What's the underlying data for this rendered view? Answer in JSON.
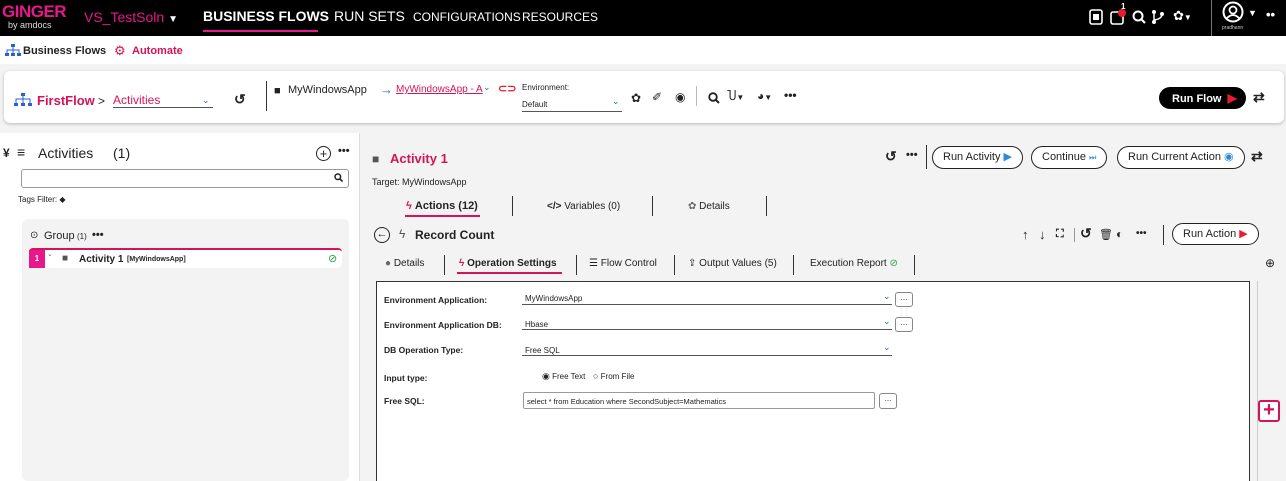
{
  "topbar": {
    "logo_text": "GINGER",
    "logo_sub": "by amdocs",
    "solution": "VS_TestSoln",
    "nav": [
      "BUSINESS FLOWS",
      "RUN SETS",
      "CONFIGURATIONS",
      "RESOURCES"
    ],
    "user": "pradhann",
    "badge_count": "1"
  },
  "breadcrumb": {
    "item1": "Business Flows",
    "item2": "Automate"
  },
  "toolbar": {
    "flow_name": "FirstFlow",
    "separator": ">",
    "view": "Activities",
    "target_app": "MyWindowsApp",
    "target_mapping": "MyWindowsApp - A",
    "environment_label": "Environment:",
    "environment_value": "Default",
    "run_flow": "Run Flow"
  },
  "left_panel": {
    "title": "Activities",
    "count": "(1)",
    "search_placeholder": "",
    "tags_filter": "Tags Filter:",
    "group_name": "Group",
    "group_count": "(1)",
    "activity_index": "1",
    "activity_name": "Activity 1",
    "activity_target": "[MyWindowsApp]"
  },
  "activity": {
    "title": "Activity 1",
    "target": "Target: MyWindowsApp",
    "run_activity": "Run Activity",
    "continue": "Continue",
    "run_current_action": "Run Current Action",
    "tabs": [
      "Actions (12)",
      "Variables (0)",
      "Details"
    ]
  },
  "action": {
    "name": "Record Count",
    "run_action": "Run Action",
    "tabs": [
      "Details",
      "Operation Settings",
      "Flow Control",
      "Output Values (5)",
      "Execution Report"
    ]
  },
  "form": {
    "env_app_label": "Environment Application:",
    "env_app_value": "MyWindowsApp",
    "env_db_label": "Environment Application DB:",
    "env_db_value": "Hbase",
    "db_op_label": "DB Operation Type:",
    "db_op_value": "Free SQL",
    "input_type_label": "Input type:",
    "input_opt1": "Free Text",
    "input_opt2": "From File",
    "free_sql_label": "Free SQL:",
    "free_sql_value": "select  * from Education where SecondSubject=Mathematics",
    "browse": "..."
  },
  "colors": {
    "accent": "#d4145a",
    "blue": "#2b5fd9",
    "green": "#2ea043"
  }
}
